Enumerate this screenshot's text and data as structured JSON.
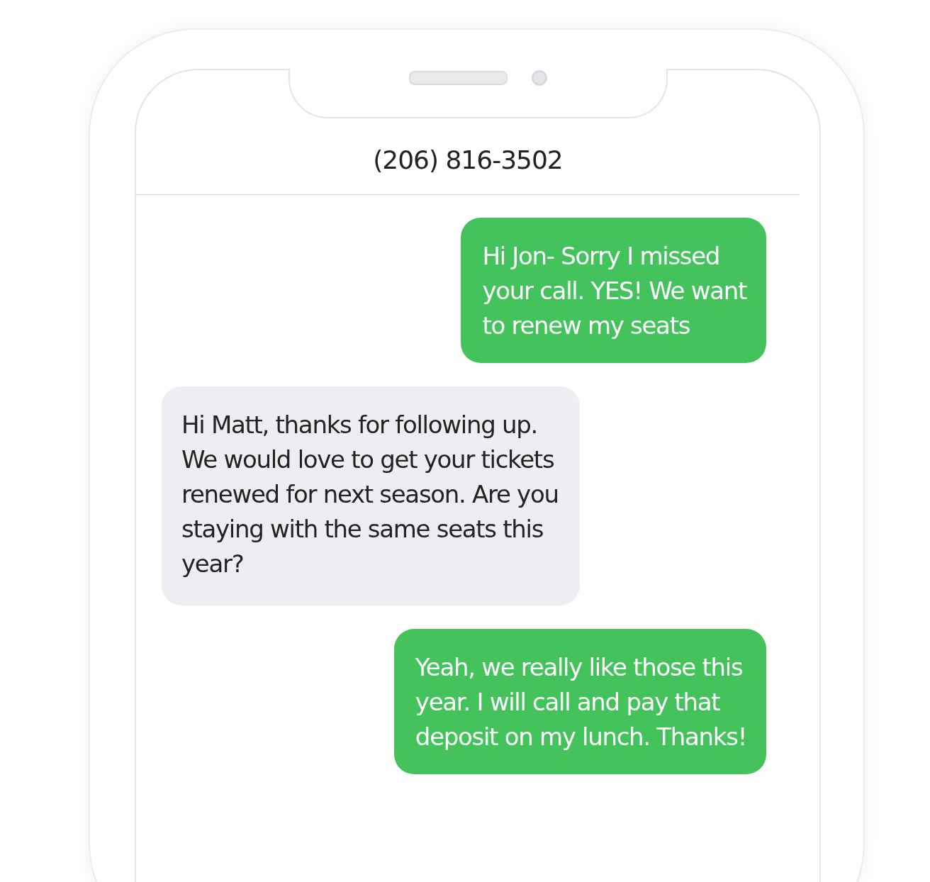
{
  "contact": {
    "phone": "(206) 816-3502"
  },
  "messages": [
    {
      "kind": "sent",
      "text": "Hi Jon- Sorry I missed\nyour call. YES! We want\nto renew my seats"
    },
    {
      "kind": "received",
      "text": "Hi Matt, thanks for following up.\nWe would love to get your tickets\nrenewed for next season.  Are you\nstaying with the same seats this\nyear?"
    },
    {
      "kind": "sent",
      "text": "Yeah, we really like those this\nyear. I will call and pay that\ndeposit on my lunch. Thanks!"
    }
  ]
}
